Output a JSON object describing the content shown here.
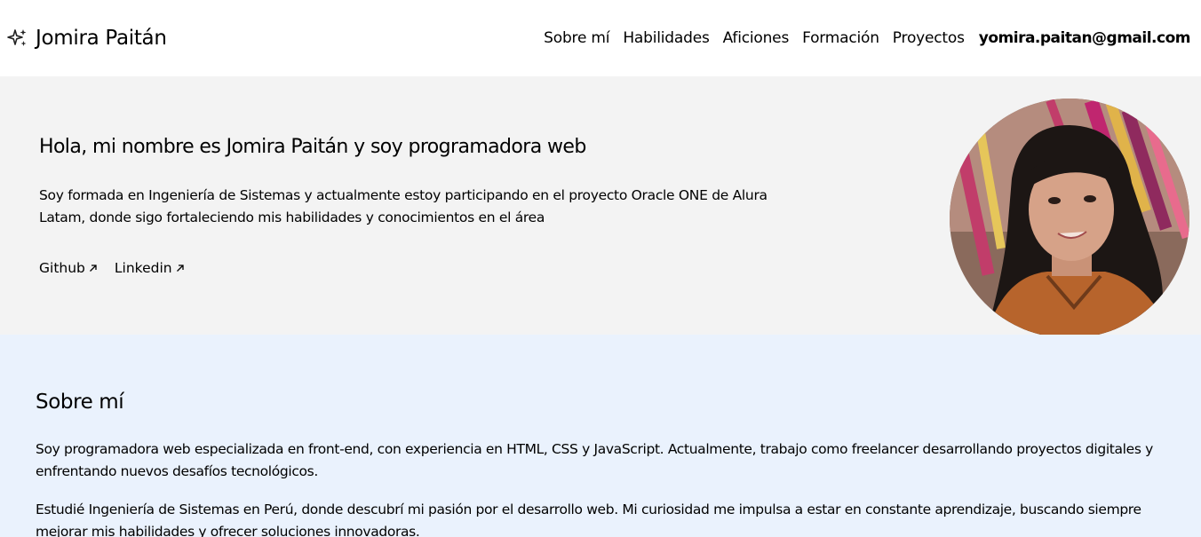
{
  "header": {
    "brand_icon": "sparkles-icon",
    "brand_name": "Jomira Paitán",
    "nav": [
      {
        "label": "Sobre mí"
      },
      {
        "label": "Habilidades"
      },
      {
        "label": "Aficiones"
      },
      {
        "label": "Formación"
      },
      {
        "label": "Proyectos"
      }
    ],
    "email": "yomira.paitan@gmail.com"
  },
  "hero": {
    "title": "Hola, mi nombre es Jomira Paitán y soy programadora web",
    "description": "Soy formada en Ingeniería de Sistemas y actualmente estoy participando en el proyecto Oracle ONE de Alura Latam, donde sigo fortaleciendo mis habilidades y conocimientos en el área",
    "links": [
      {
        "label": "Github",
        "icon": "arrow-up-right-icon"
      },
      {
        "label": "Linkedin",
        "icon": "arrow-up-right-icon"
      }
    ]
  },
  "about": {
    "title": "Sobre mí",
    "paragraphs": [
      "Soy programadora web especializada en front-end, con experiencia en HTML, CSS y JavaScript. Actualmente, trabajo como freelancer desarrollando proyectos digitales y enfrentando nuevos desafíos tecnológicos.",
      "Estudié Ingeniería de Sistemas en Perú, donde descubrí mi pasión por el desarrollo web. Mi curiosidad me impulsa a estar en constante aprendizaje, buscando siempre mejorar mis habilidades y ofrecer soluciones innovadoras."
    ]
  },
  "colors": {
    "header_bg": "#ffffff",
    "hero_bg": "#f3f3f3",
    "about_bg": "#eaf2fd",
    "text": "#000000"
  }
}
